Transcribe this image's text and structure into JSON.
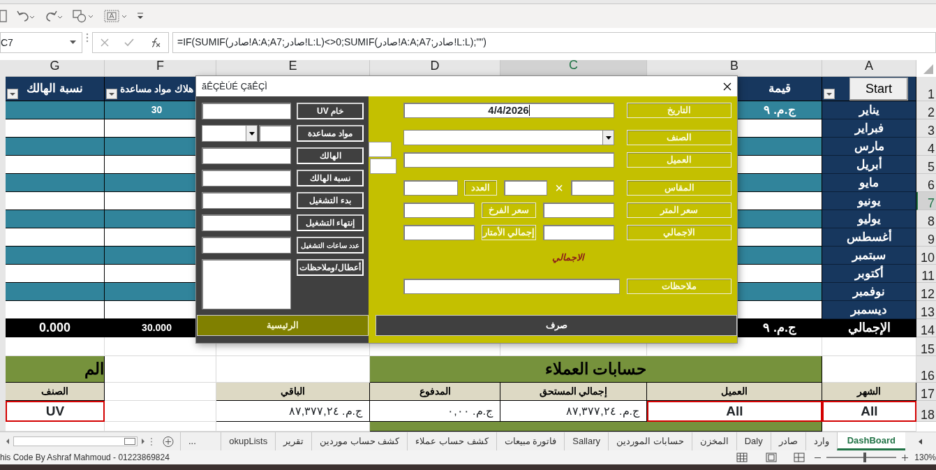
{
  "toolbar": {
    "name_box": "C7",
    "formula": "=IF(SUMIF(صادر!A:A;A7;صادر!L:L)<>0;SUMIF(صادر!A:A;A7;صادر!L:L);\"\")"
  },
  "columns": [
    {
      "letter": "A",
      "selected": false
    },
    {
      "letter": "B",
      "selected": false
    },
    {
      "letter": "C",
      "selected": true
    },
    {
      "letter": "D",
      "selected": false
    },
    {
      "letter": "E",
      "selected": false
    },
    {
      "letter": "F",
      "selected": false
    },
    {
      "letter": "G",
      "selected": false
    }
  ],
  "rows": [
    {
      "num": "1",
      "selected": false,
      "cells": [
        {
          "kind": "header",
          "button": "Start",
          "filter": true
        },
        {
          "kind": "header",
          "text": "قيمة"
        },
        {
          "kind": "hidden"
        },
        {
          "kind": "hidden"
        },
        {
          "kind": "hidden"
        },
        {
          "kind": "header",
          "text": "هلاك مواد مساعدة",
          "filter": true
        },
        {
          "kind": "header",
          "text": "نسبة الهالك",
          "filter": true
        }
      ]
    },
    {
      "num": "2",
      "selected": false,
      "cells": [
        {
          "kind": "month",
          "text": "يناير"
        },
        {
          "kind": "teal",
          "text": "ج.م. ٩"
        },
        {
          "kind": "hidden"
        },
        {
          "kind": "hidden"
        },
        {
          "kind": "hidden"
        },
        {
          "kind": "teal",
          "text": "30"
        },
        {
          "kind": "teal"
        }
      ]
    },
    {
      "num": "3",
      "selected": false,
      "cells": [
        {
          "kind": "month",
          "text": "فبراير"
        },
        {
          "kind": "white"
        },
        {
          "kind": "hidden"
        },
        {
          "kind": "hidden"
        },
        {
          "kind": "hidden"
        },
        {
          "kind": "white"
        },
        {
          "kind": "white"
        }
      ]
    },
    {
      "num": "4",
      "selected": false,
      "cells": [
        {
          "kind": "month",
          "text": "مارس"
        },
        {
          "kind": "teal"
        },
        {
          "kind": "hidden"
        },
        {
          "kind": "hidden"
        },
        {
          "kind": "hidden"
        },
        {
          "kind": "teal"
        },
        {
          "kind": "teal"
        }
      ]
    },
    {
      "num": "5",
      "selected": false,
      "cells": [
        {
          "kind": "month",
          "text": "أبريل"
        },
        {
          "kind": "white"
        },
        {
          "kind": "hidden"
        },
        {
          "kind": "hidden"
        },
        {
          "kind": "hidden"
        },
        {
          "kind": "white"
        },
        {
          "kind": "white"
        }
      ]
    },
    {
      "num": "6",
      "selected": false,
      "cells": [
        {
          "kind": "month",
          "text": "مايو"
        },
        {
          "kind": "teal"
        },
        {
          "kind": "hidden"
        },
        {
          "kind": "hidden"
        },
        {
          "kind": "hidden"
        },
        {
          "kind": "teal"
        },
        {
          "kind": "teal"
        }
      ]
    },
    {
      "num": "7",
      "selected": true,
      "cells": [
        {
          "kind": "month",
          "text": "يونيو"
        },
        {
          "kind": "white"
        },
        {
          "kind": "hidden"
        },
        {
          "kind": "hidden"
        },
        {
          "kind": "hidden"
        },
        {
          "kind": "white"
        },
        {
          "kind": "white"
        }
      ]
    },
    {
      "num": "8",
      "selected": false,
      "cells": [
        {
          "kind": "month",
          "text": "يوليو"
        },
        {
          "kind": "teal"
        },
        {
          "kind": "hidden"
        },
        {
          "kind": "hidden"
        },
        {
          "kind": "hidden"
        },
        {
          "kind": "teal"
        },
        {
          "kind": "teal"
        }
      ]
    },
    {
      "num": "9",
      "selected": false,
      "cells": [
        {
          "kind": "month",
          "text": "أغسطس"
        },
        {
          "kind": "white"
        },
        {
          "kind": "hidden"
        },
        {
          "kind": "hidden"
        },
        {
          "kind": "hidden"
        },
        {
          "kind": "white"
        },
        {
          "kind": "white"
        }
      ]
    },
    {
      "num": "10",
      "selected": false,
      "cells": [
        {
          "kind": "month",
          "text": "سبتمبر"
        },
        {
          "kind": "teal"
        },
        {
          "kind": "hidden"
        },
        {
          "kind": "hidden"
        },
        {
          "kind": "hidden"
        },
        {
          "kind": "teal"
        },
        {
          "kind": "teal"
        }
      ]
    },
    {
      "num": "11",
      "selected": false,
      "cells": [
        {
          "kind": "month",
          "text": "أكتوبر"
        },
        {
          "kind": "white"
        },
        {
          "kind": "hidden"
        },
        {
          "kind": "hidden"
        },
        {
          "kind": "hidden"
        },
        {
          "kind": "white"
        },
        {
          "kind": "white"
        }
      ]
    },
    {
      "num": "12",
      "selected": false,
      "cells": [
        {
          "kind": "month",
          "text": "نوفمبر"
        },
        {
          "kind": "teal"
        },
        {
          "kind": "hidden"
        },
        {
          "kind": "hidden"
        },
        {
          "kind": "hidden"
        },
        {
          "kind": "teal"
        },
        {
          "kind": "teal"
        }
      ]
    },
    {
      "num": "13",
      "selected": false,
      "cells": [
        {
          "kind": "month",
          "text": "ديسمبر"
        },
        {
          "kind": "white"
        },
        {
          "kind": "hidden"
        },
        {
          "kind": "hidden"
        },
        {
          "kind": "hidden"
        },
        {
          "kind": "white"
        },
        {
          "kind": "white"
        }
      ]
    },
    {
      "num": "14",
      "selected": false,
      "cells": [
        {
          "kind": "total",
          "text": "الإجمالي"
        },
        {
          "kind": "total",
          "text": "ج.م. ٩"
        },
        {
          "kind": "hidden"
        },
        {
          "kind": "hidden"
        },
        {
          "kind": "hidden"
        },
        {
          "kind": "total",
          "text": "30.000"
        },
        {
          "kind": "total",
          "text": "0.000"
        }
      ]
    },
    {
      "num": "15",
      "selected": false,
      "cells": [
        {
          "kind": "blank"
        },
        {
          "kind": "blank"
        },
        {
          "kind": "blank"
        },
        {
          "kind": "blank"
        },
        {
          "kind": "blank"
        },
        {
          "kind": "blank"
        },
        {
          "kind": "blank"
        }
      ]
    },
    {
      "num": "16",
      "selected": false,
      "cells": [
        {
          "kind": "blank"
        },
        {
          "kind": "green",
          "text": "حسابات العملاء"
        },
        {
          "kind": "merged"
        },
        {
          "kind": "merged"
        },
        {
          "kind": "blank"
        },
        {
          "kind": "blank"
        },
        {
          "kind": "green",
          "text": "الم"
        }
      ]
    },
    {
      "num": "17",
      "selected": false,
      "cells": [
        {
          "kind": "beige",
          "text": "الشهر"
        },
        {
          "kind": "beige",
          "text": "العميل"
        },
        {
          "kind": "beige",
          "text": "إجمالي المستحق"
        },
        {
          "kind": "beige",
          "text": "المدفوع"
        },
        {
          "kind": "beige",
          "text": "الباقي"
        },
        {
          "kind": "blank"
        },
        {
          "kind": "beige",
          "text": "الصنف"
        }
      ]
    },
    {
      "num": "18",
      "selected": false,
      "cells": [
        {
          "kind": "outlined",
          "text": "All"
        },
        {
          "kind": "outlined",
          "text": "All"
        },
        {
          "kind": "plain",
          "text": "ج.م. ٨٧,٣٧٧,٢٤"
        },
        {
          "kind": "plain",
          "text": "ج.م. ٠,٠٠"
        },
        {
          "kind": "plain",
          "text": "ج.م. ٨٧,٣٧٧,٢٤"
        },
        {
          "kind": "blank"
        },
        {
          "kind": "outlined",
          "text": "UV"
        }
      ]
    },
    {
      "cells": [
        {
          "kind": "blank"
        },
        {
          "kind": "green"
        },
        {
          "kind": "merged"
        },
        {
          "kind": "merged"
        },
        {
          "kind": "blank"
        },
        {
          "kind": "blank"
        },
        {
          "kind": "blank"
        }
      ]
    }
  ],
  "dialog": {
    "title": "ãÊÇÈÚÉ ÇãÊÇÌ",
    "left_panel": {
      "fields": [
        {
          "label": "خام UV",
          "kind": "text"
        },
        {
          "label": "مواد مساعدة",
          "kind": "combo"
        },
        {
          "label": "الهالك",
          "kind": "text"
        },
        {
          "label": "نسبة الهالك",
          "kind": "text"
        },
        {
          "label": "بدء التشغيل",
          "kind": "text"
        },
        {
          "label": "إنتهاء التشغيل",
          "kind": "text"
        },
        {
          "label": "عدد ساعات التشغيل",
          "kind": "text"
        },
        {
          "label": "أعطال/وملاحظات",
          "kind": "memo"
        }
      ],
      "button": "الرئيسية"
    },
    "right_panel": {
      "rows": [
        {
          "kind": "text",
          "label": "التاريخ",
          "value": "4/4/2026",
          "focused": true
        },
        {
          "kind": "combo",
          "label": "الصنف"
        },
        {
          "kind": "text",
          "label": "العميل"
        },
        {
          "kind": "size",
          "label": "المقاس",
          "times": "×",
          "count_label": "العدد"
        },
        {
          "kind": "pair",
          "label": "سعر المتر",
          "mid_label": "سعر الفرخ"
        },
        {
          "kind": "pair",
          "label": "الاجمالي",
          "mid_label": "إجمالي الأمتار"
        },
        {
          "kind": "caption",
          "text": "الاجمالي"
        },
        {
          "kind": "wide",
          "label": "ملاحظات"
        }
      ],
      "button": "صرف"
    }
  },
  "sheet_tabs": [
    {
      "label": "DashBoard",
      "selected": true
    },
    {
      "label": "وارد",
      "selected": false
    },
    {
      "label": "صادر",
      "selected": false
    },
    {
      "label": "Daly",
      "selected": false
    },
    {
      "label": "المخزن",
      "selected": false
    },
    {
      "label": "حسابات الموردين",
      "selected": false
    },
    {
      "label": "Sallary",
      "selected": false
    },
    {
      "label": "فاتورة مبيعات",
      "selected": false
    },
    {
      "label": "كشف حساب عملاء",
      "selected": false
    },
    {
      "label": "كشف حساب موردين",
      "selected": false
    },
    {
      "label": "تقرير",
      "selected": false
    },
    {
      "label": "okupLists",
      "selected": false
    }
  ],
  "more_tabs": "...",
  "status_bar": {
    "text": "his Code By  Ashraf Mahmoud  -  01223869824",
    "zoom": {
      "text": "130%",
      "level": 0.55
    }
  }
}
